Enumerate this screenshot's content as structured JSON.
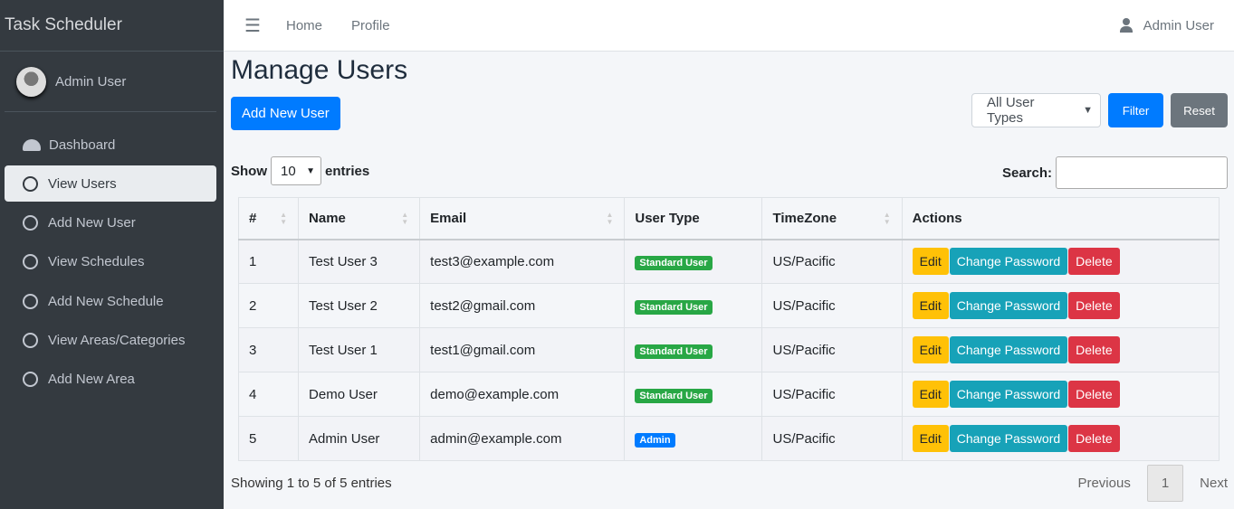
{
  "brand": "Task Scheduler",
  "sidebar": {
    "user": "Admin User",
    "items": [
      {
        "label": "Dashboard",
        "icon": "dashboard-icon"
      },
      {
        "label": "View Users",
        "icon": "circle-icon",
        "active": true
      },
      {
        "label": "Add New User",
        "icon": "circle-icon"
      },
      {
        "label": "View Schedules",
        "icon": "circle-icon"
      },
      {
        "label": "Add New Schedule",
        "icon": "circle-icon"
      },
      {
        "label": "View Areas/Categories",
        "icon": "circle-icon"
      },
      {
        "label": "Add New Area",
        "icon": "circle-icon"
      }
    ]
  },
  "topbar": {
    "home": "Home",
    "profile": "Profile",
    "user": "Admin User"
  },
  "main": {
    "title": "Manage Users",
    "add_button": "Add New User",
    "user_type_select": "All User Types",
    "filter": "Filter",
    "reset": "Reset",
    "show": "Show",
    "length": "10",
    "entries": "entries",
    "search_label": "Search:",
    "search_value": "",
    "columns": [
      "#",
      "Name",
      "Email",
      "User Type",
      "TimeZone",
      "Actions"
    ],
    "rows": [
      {
        "num": "1",
        "name": "Test User 3",
        "email": "test3@example.com",
        "type": "Standard User",
        "tz": "US/Pacific"
      },
      {
        "num": "2",
        "name": "Test User 2",
        "email": "test2@gmail.com",
        "type": "Standard User",
        "tz": "US/Pacific"
      },
      {
        "num": "3",
        "name": "Test User 1",
        "email": "test1@gmail.com",
        "type": "Standard User",
        "tz": "US/Pacific"
      },
      {
        "num": "4",
        "name": "Demo User",
        "email": "demo@example.com",
        "type": "Standard User",
        "tz": "US/Pacific"
      },
      {
        "num": "5",
        "name": "Admin User",
        "email": "admin@example.com",
        "type": "Admin",
        "tz": "US/Pacific"
      }
    ],
    "actions": {
      "edit": "Edit",
      "change_password": "Change Password",
      "delete": "Delete"
    },
    "info": "Showing 1 to 5 of 5 entries",
    "previous": "Previous",
    "page": "1",
    "next": "Next"
  },
  "colors": {
    "primary": "#007bff",
    "success": "#28a745",
    "warning": "#ffc107",
    "info": "#17a2b8",
    "danger": "#dc3545",
    "sidebar": "#343a40"
  }
}
